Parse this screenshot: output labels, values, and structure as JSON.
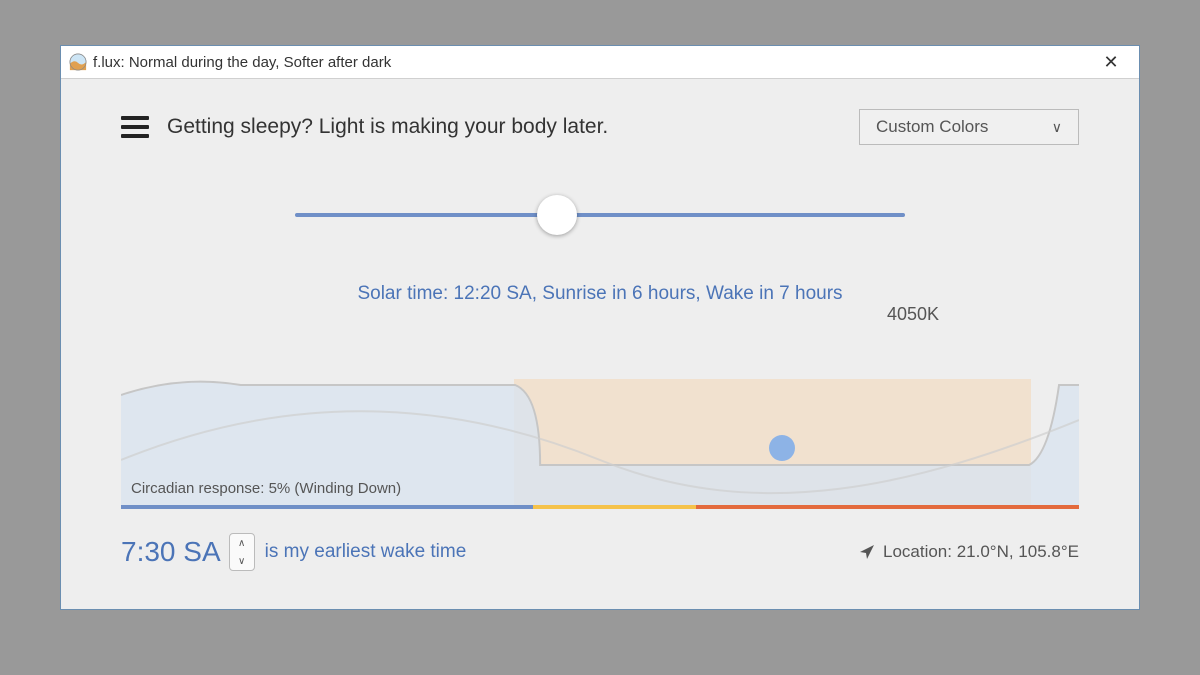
{
  "window": {
    "title": "f.lux: Normal during the day, Softer after dark"
  },
  "header": {
    "message": "Getting sleepy? Light is making your body later.",
    "preset_label": "Custom Colors"
  },
  "slider": {
    "temp_label": "4050K",
    "percent": 43
  },
  "solar_line": "Solar time: 12:20 SA, Sunrise in 6 hours, Wake in 7 hours",
  "graph": {
    "circadian_label": "Circadian response: 5% (Winding Down)",
    "night_band_start_pct": 41,
    "night_band_end_pct": 95,
    "now_dot_pct_x": 69,
    "now_dot_pct_y": 55,
    "colorbar": {
      "blue_pct": 43,
      "yellow_pct": 17,
      "red_pct": 40
    }
  },
  "wake": {
    "time": "7:30 SA",
    "label": "is my earliest wake time"
  },
  "location": {
    "label": "Location: 21.0°N, 105.8°E"
  },
  "colors": {
    "accent": "#4b74b7",
    "slider_track": "#6f8fc7"
  }
}
